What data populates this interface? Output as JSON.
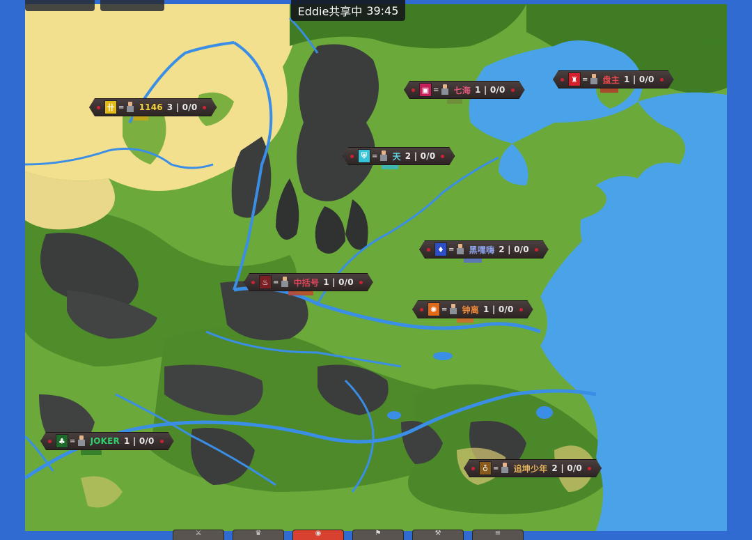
{
  "share_banner": {
    "text": "Eddie共享中",
    "time": "39:45"
  },
  "kingdoms": [
    {
      "name": "1146",
      "stats": "3 | 0/0",
      "emblem_icon": "ladder-emblem-icon",
      "emblem_glyph": "卄",
      "emblem_bg": "#e3b916",
      "name_color": "#f2d23a"
    },
    {
      "name": "七海",
      "stats": "1 | 0/0",
      "emblem_icon": "crest-emblem-icon",
      "emblem_glyph": "▣",
      "emblem_bg": "#c81f5a",
      "name_color": "#e05a78"
    },
    {
      "name": "盘主",
      "stats": "1 | 0/0",
      "emblem_icon": "tower-emblem-icon",
      "emblem_glyph": "♜",
      "emblem_bg": "#d8202c",
      "name_color": "#e8494f"
    },
    {
      "name": "天",
      "stats": "2 | 0/0",
      "emblem_icon": "shield-emblem-icon",
      "emblem_glyph": "⛨",
      "emblem_bg": "#37c4d8",
      "name_color": "#63d9e6"
    },
    {
      "name": "黑嘿嗨",
      "stats": "2 | 0/0",
      "emblem_icon": "flame-emblem-icon",
      "emblem_glyph": "♦",
      "emblem_bg": "#2c4fc8",
      "name_color": "#8ea4ec"
    },
    {
      "name": "中括号",
      "stats": "1 | 0/0",
      "emblem_icon": "fire-emblem-icon",
      "emblem_glyph": "♨",
      "emblem_bg": "#7a1f24",
      "name_color": "#e0455a"
    },
    {
      "name": "钟离",
      "stats": "1 | 0/0",
      "emblem_icon": "sun-emblem-icon",
      "emblem_glyph": "✺",
      "emblem_bg": "#e06a1a",
      "name_color": "#f08a3a"
    },
    {
      "name": "JOKER",
      "stats": "1 | 0/0",
      "emblem_icon": "tree-emblem-icon",
      "emblem_glyph": "♣",
      "emblem_bg": "#1e6a2a",
      "name_color": "#2fd06a"
    },
    {
      "name": "追坤少年",
      "stats": "2 | 0/0",
      "emblem_icon": "pouch-emblem-icon",
      "emblem_glyph": "♁",
      "emblem_bg": "#8a5a1a",
      "name_color": "#e6b25a"
    }
  ],
  "toolbar": {
    "buttons": [
      {
        "icon": "sword-icon",
        "glyph": "⚔"
      },
      {
        "icon": "crown-icon",
        "glyph": "♛"
      },
      {
        "icon": "eye-icon",
        "glyph": "◉",
        "active": true
      },
      {
        "icon": "flag-icon",
        "glyph": "⚑"
      },
      {
        "icon": "tools-icon",
        "glyph": "⚒"
      },
      {
        "icon": "menu-icon",
        "glyph": "≡"
      }
    ]
  },
  "colors": {
    "ocean": "#4aa3e8",
    "frame": "#2f6bd1",
    "grass": "#6aa93a",
    "sand": "#f2e08e",
    "mountain": "#3a3d3c",
    "river": "#3a8ee6",
    "forest": "#2f6e1e"
  }
}
